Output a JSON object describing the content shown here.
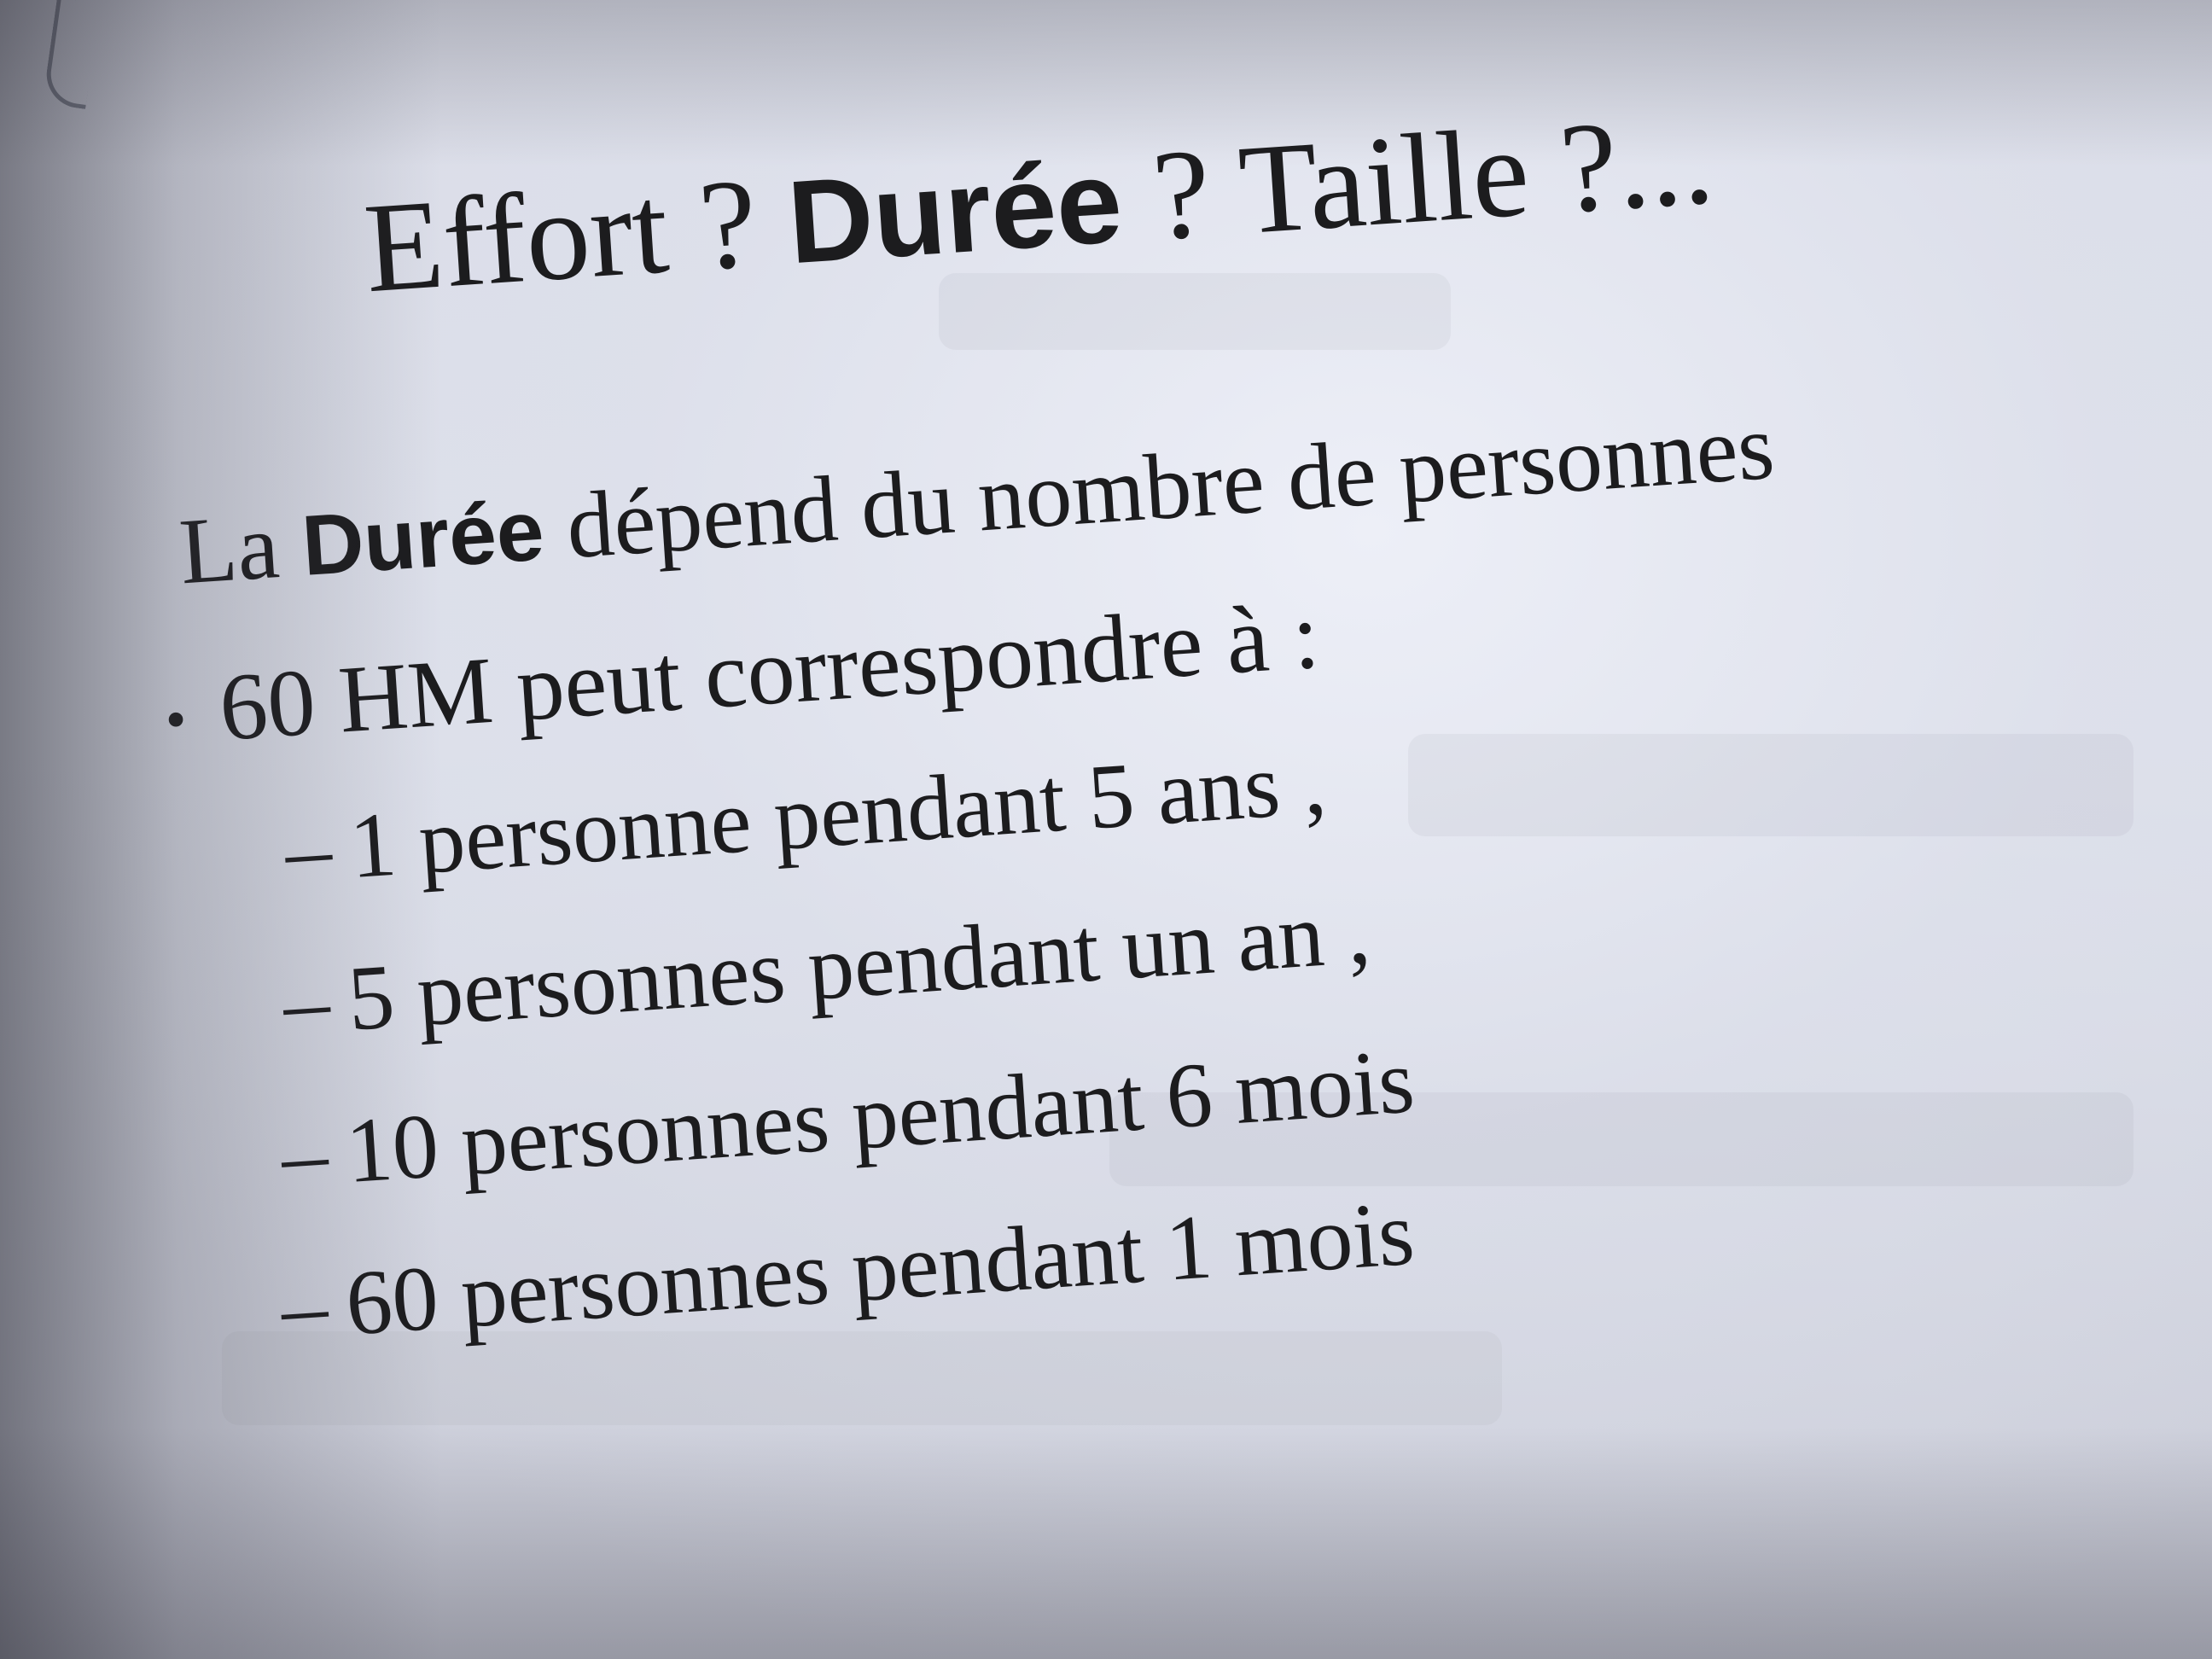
{
  "slide": {
    "title_part1": "Effort ? ",
    "title_bold": "Durée",
    "title_part2": " ? Taille ?...",
    "intro_prefix": "La ",
    "intro_bold": "Durée",
    "intro_suffix": " dépend du nombre de personnes",
    "bullet_symbol": "•",
    "bullet_text": "60 HM peut correspondre à :",
    "dash_symbol": "–",
    "sub_items": [
      "1 personne pendant 5 ans ,",
      "5 personnes pendant un an ,",
      "10 personnes pendant 6 mois",
      "60 personnes pendant 1 mois"
    ]
  },
  "colors": {
    "ink": "#1c1c1e",
    "paper": "#dcdfe9"
  }
}
